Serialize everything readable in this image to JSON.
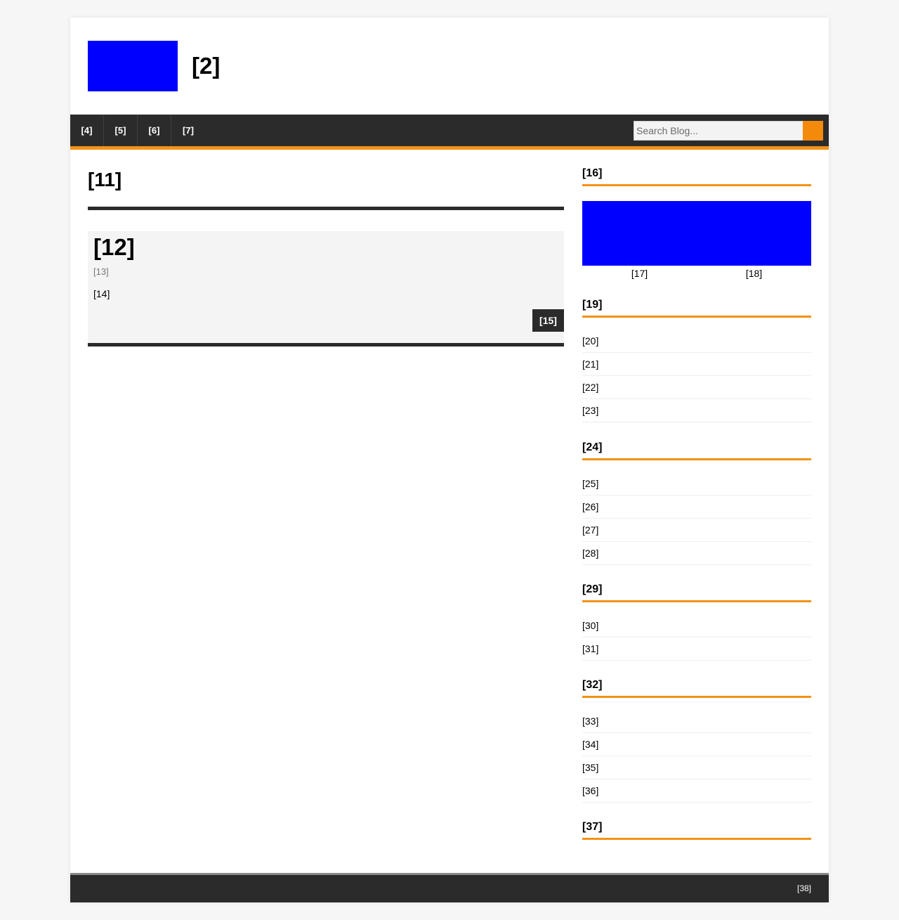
{
  "header": {
    "site_title": "[2]"
  },
  "nav": {
    "items": [
      "[4]",
      "[5]",
      "[6]",
      "[7]"
    ],
    "search_placeholder": "Search Blog..."
  },
  "main": {
    "title": "[11]",
    "post": {
      "title": "[12]",
      "meta": "[13]",
      "excerpt": "[14]",
      "read_more": "[15]"
    }
  },
  "sidebar": {
    "ad_widget": {
      "title": "[16]",
      "captions": [
        "[17]",
        "[18]"
      ]
    },
    "widget1": {
      "title": "[19]",
      "items": [
        "[20]",
        "[21]",
        "[22]",
        "[23]"
      ]
    },
    "widget2": {
      "title": "[24]",
      "items": [
        "[25]",
        "[26]",
        "[27]",
        "[28]"
      ]
    },
    "widget3": {
      "title": "[29]",
      "items": [
        "[30]",
        "[31]"
      ]
    },
    "widget4": {
      "title": "[32]",
      "items": [
        "[33]",
        "[34]",
        "[35]",
        "[36]"
      ]
    },
    "widget5": {
      "title": "[37]"
    }
  },
  "footer": {
    "text": "[38]"
  },
  "colors": {
    "accent": "#f39217",
    "dark": "#2b2b2b",
    "placeholder_image": "#0000ff"
  }
}
